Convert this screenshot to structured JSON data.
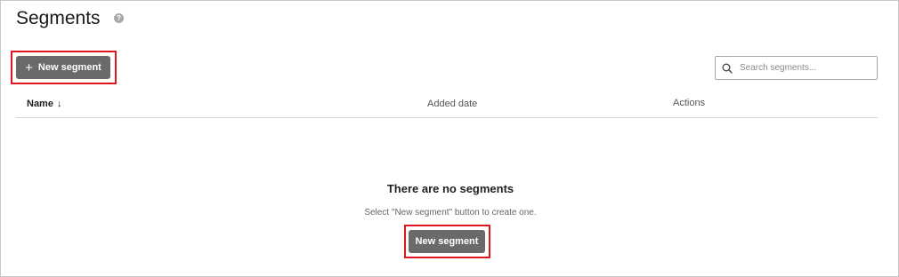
{
  "page": {
    "title": "Segments",
    "help_icon": "question-icon"
  },
  "toolbar": {
    "new_segment_label": "New segment",
    "new_segment_icon": "plus-icon"
  },
  "search": {
    "placeholder": "Search segments...",
    "value": "",
    "icon": "search-icon"
  },
  "table": {
    "columns": [
      {
        "label": "Name",
        "sort": "descending"
      },
      {
        "label": "Added date"
      },
      {
        "label": "Actions"
      }
    ],
    "rows": []
  },
  "empty_state": {
    "title": "There are no segments",
    "message": "Select \"New segment\" button to create one.",
    "button_label": "New segment"
  },
  "colors": {
    "button_bg": "#6a6a6a",
    "highlight": "#e0161e",
    "divider": "#d6d6d6"
  }
}
